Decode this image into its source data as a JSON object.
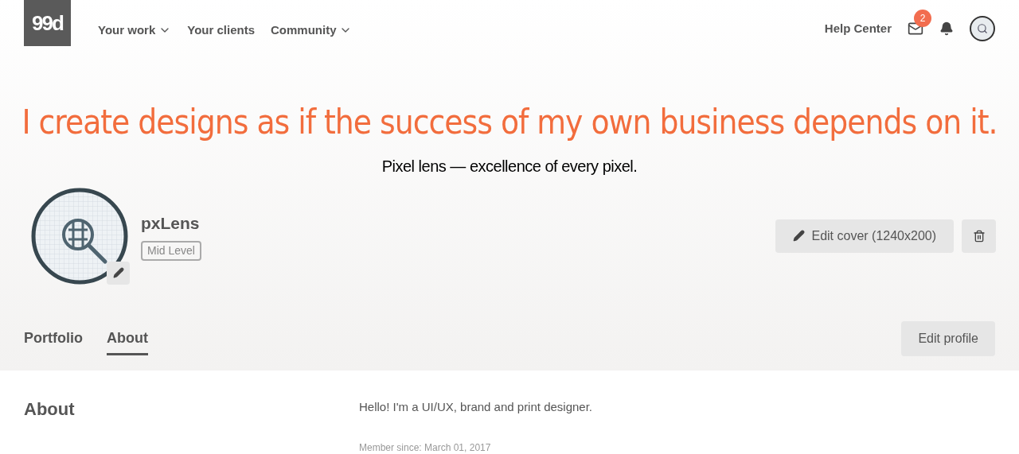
{
  "logo": "99d",
  "nav": [
    {
      "label": "Your work",
      "dropdown": true
    },
    {
      "label": "Your clients",
      "dropdown": false
    },
    {
      "label": "Community",
      "dropdown": true
    }
  ],
  "help": "Help Center",
  "messages_badge": "2",
  "cover": {
    "headline": "I create designs as if the success of my own business depends on it.",
    "tagline": "Pixel lens — excellence of every pixel.",
    "edit_cover": "Edit cover (1240x200)"
  },
  "profile": {
    "name": "pxLens",
    "level": "Mid Level"
  },
  "tabs": [
    {
      "label": "Portfolio",
      "selected": false
    },
    {
      "label": "About",
      "selected": true
    }
  ],
  "edit_profile": "Edit profile",
  "about": {
    "heading": "About",
    "bio": "Hello! I'm a UI/UX, brand and print designer.",
    "member_since": "Member since: March 01, 2017"
  }
}
